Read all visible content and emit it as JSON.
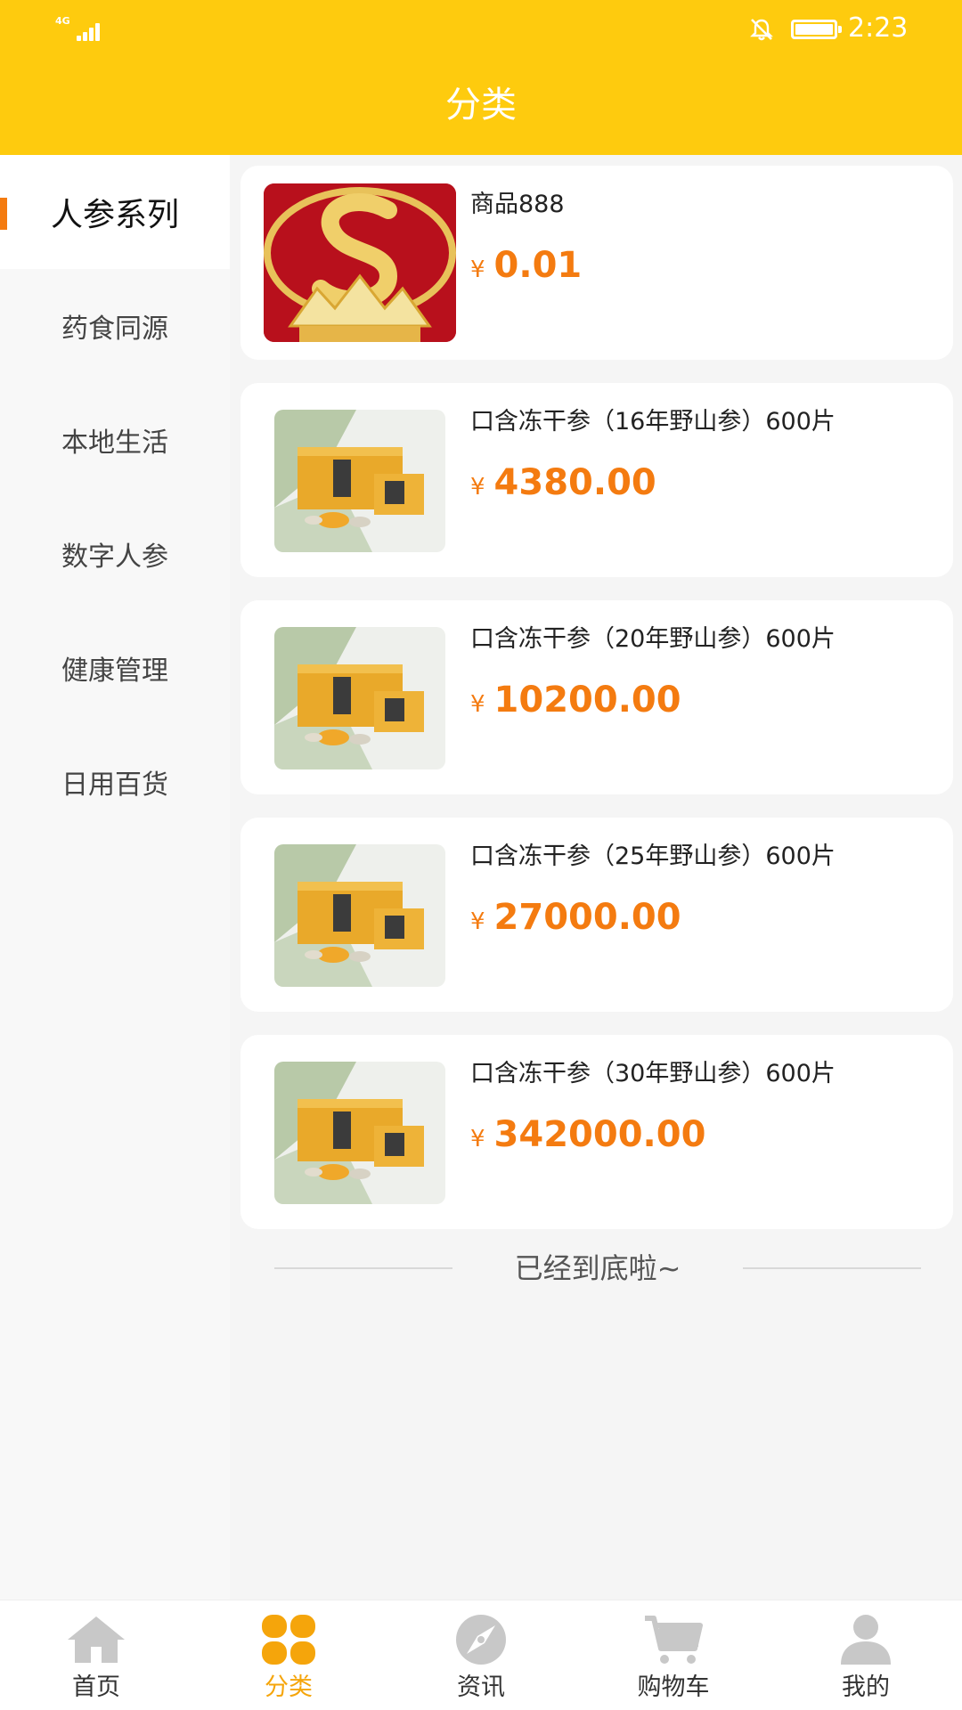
{
  "status_bar": {
    "network": "4G",
    "time": "2:23"
  },
  "header": {
    "title": "分类"
  },
  "sidebar": {
    "items": [
      {
        "label": "人参系列",
        "active": true
      },
      {
        "label": "药食同源"
      },
      {
        "label": "本地生活"
      },
      {
        "label": "数字人参"
      },
      {
        "label": "健康管理"
      },
      {
        "label": "日用百货"
      }
    ]
  },
  "products": [
    {
      "name": "商品888",
      "currency": "¥",
      "price": "0.01"
    },
    {
      "name": "口含冻干参（16年野山参）600片",
      "currency": "¥",
      "price": "4380.00"
    },
    {
      "name": "口含冻干参（20年野山参）600片",
      "currency": "¥",
      "price": "10200.00"
    },
    {
      "name": "口含冻干参（25年野山参）600片",
      "currency": "¥",
      "price": "27000.00"
    },
    {
      "name": "口含冻干参（30年野山参）600片",
      "currency": "¥",
      "price": "342000.00"
    }
  ],
  "list_end_text": "已经到底啦~",
  "tabbar": {
    "items": [
      {
        "label": "首页",
        "icon": "home-icon"
      },
      {
        "label": "分类",
        "icon": "category-icon",
        "active": true
      },
      {
        "label": "资讯",
        "icon": "compass-icon"
      },
      {
        "label": "购物车",
        "icon": "cart-icon"
      },
      {
        "label": "我的",
        "icon": "user-icon"
      }
    ]
  },
  "colors": {
    "brand_yellow": "#fecb0e",
    "price_orange": "#f47b10",
    "tab_active": "#f5a50b",
    "tab_inactive": "#c8c8c8"
  }
}
